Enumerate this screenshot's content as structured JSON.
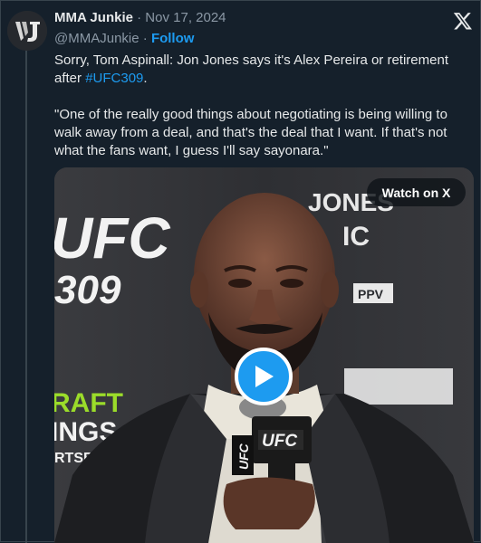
{
  "author": {
    "name": "MMA Junkie",
    "handle": "@MMAJunkie",
    "date": "Nov 17, 2024",
    "separator": "·",
    "follow_label": "Follow"
  },
  "tweet": {
    "line1_before": "Sorry, Tom Aspinall: Jon Jones says it's Alex Pereira or retirement after",
    "hashtag": "#UFC309",
    "line1_after": ".",
    "quote": "\"One of the really good things about negotiating is being willing to walk away from a deal, and that's the deal that I want. If that's not what the fans want, I guess I'll say sayonara.\""
  },
  "media": {
    "watch_label": "Watch on X",
    "backdrop_text_left_1": "UFC",
    "backdrop_text_left_2": "309",
    "backdrop_text_left_3": "RAFT",
    "backdrop_text_left_4": "INGS",
    "backdrop_text_left_5": "RTSB",
    "backdrop_text_right_1": "JONES",
    "backdrop_text_right_2": "IC",
    "backdrop_text_right_3": "PPV",
    "mic_flag_text": "UFC",
    "mic_side_text": "UFC"
  },
  "colors": {
    "background": "#15202b",
    "accent": "#1d9bf0",
    "muted": "#8b98a5",
    "text": "#e7e9ea"
  },
  "icons": {
    "avatar": "mma-junkie-logo",
    "x_logo": "x-logo-icon",
    "play": "play-icon"
  }
}
